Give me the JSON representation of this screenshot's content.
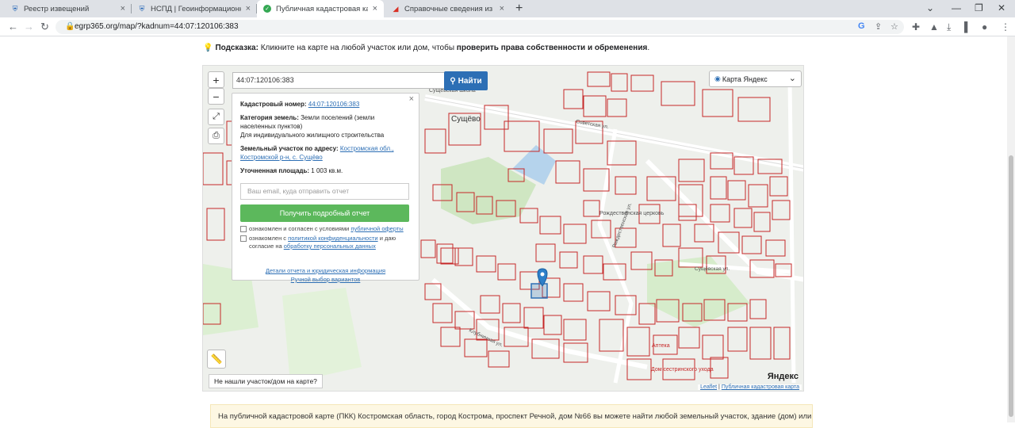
{
  "browser": {
    "tabs": [
      {
        "title": "Реестр извещений",
        "icon": "shield-icon"
      },
      {
        "title": "НСПД | Геоинформационный п",
        "icon": "shield-icon"
      },
      {
        "title": "Публичная кадастровая карта",
        "icon": "check-icon"
      },
      {
        "title": "Справочные сведения из ФГИС",
        "icon": "map-icon"
      }
    ],
    "url": "egrp365.org/map/?kadnum=44:07:120106:383"
  },
  "hint": {
    "label": "Подсказка:",
    "text": "Кликните на карте на любой участок или дом, чтобы",
    "bold": "проверить права собственности и обременения",
    "end": "."
  },
  "map": {
    "search_value": "44:07:120106:383",
    "search_button": "Найти",
    "layer": "Карта Яндекс",
    "zoom_in": "+",
    "zoom_out": "−",
    "not_found": "Не нашли участок/дом на карте?",
    "attribution_leaflet": "Leaflet",
    "attribution_sep": "|",
    "attribution_pkk": "Публичная кадастровая карта",
    "yandex": "Яндекс",
    "labels": {
      "village": "Сущёво",
      "church": "Рождественская церковь",
      "pharmacy": "Аптека",
      "school": "Сущёвская школа",
      "home": "Дом сестринского ухода",
      "street1": "Советская ул.",
      "street2": "Сущёвская ул.",
      "street3": "Клубничная ул.",
      "street4": "Рождественская ул."
    }
  },
  "popup": {
    "kad_label": "Кадастровый номер:",
    "kad_value": "44:07:120106:383",
    "cat_label": "Категория земель:",
    "cat_value": "Земли поселений (земли населенных пунктов)",
    "use_value": "Для индивидуального жилищного строительства",
    "addr_label": "Земельный участок по адресу:",
    "addr_value": "Костромская обл., Костромской р-н, с. Сущёво",
    "area_label": "Уточненная площадь:",
    "area_value": "1 003 кв.м.",
    "email_placeholder": "Ваш email, куда отправить отчет",
    "get_button": "Получить подробный отчет",
    "check1_text": "ознакомлен и согласен с условиями",
    "check1_link": "публичной оферты",
    "check2_text": "ознакомлен с",
    "check2_link": "политикой конфиденциальности",
    "check2_text2": "и даю согласие на",
    "check2_link2": "обработку персональных данных",
    "details_link": "Детали отчета и юридическая информация",
    "manual_link": "Ручной выбор вариантов"
  },
  "info": {
    "text": "На публичной кадастровой карте (ПКК) Костромская область, город Кострома, проспект Речной, дом №66 вы можете найти любой земельный участок, здание (дом) или"
  }
}
